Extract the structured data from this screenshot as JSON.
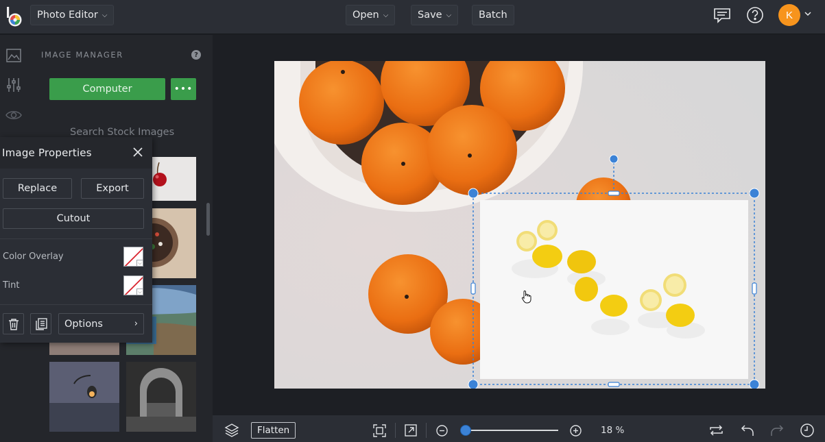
{
  "header": {
    "app_menu_label": "Photo Editor",
    "open_label": "Open",
    "save_label": "Save",
    "batch_label": "Batch",
    "avatar_initial": "K"
  },
  "image_manager": {
    "title": "IMAGE MANAGER",
    "help_glyph": "?",
    "computer_label": "Computer",
    "more_label": "•••",
    "stock_search_label": "Search Stock Images"
  },
  "image_properties": {
    "title": "Image Properties",
    "replace_label": "Replace",
    "export_label": "Export",
    "cutout_label": "Cutout",
    "color_overlay_label": "Color Overlay",
    "tint_label": "Tint",
    "options_label": "Options"
  },
  "bottom_bar": {
    "flatten_label": "Flatten",
    "zoom_text": "18 %",
    "zoom_level": 0.18
  },
  "colors": {
    "accent_blue": "#3b82d6",
    "computer_green": "#3a9d4b",
    "avatar_orange": "#f7941d"
  },
  "icons": {
    "rail": [
      "image-icon",
      "sliders-icon",
      "eye-icon"
    ],
    "header_right": [
      "comment-icon",
      "help-icon"
    ],
    "bottom": [
      "layers-icon",
      "fit-screen-icon",
      "expand-icon",
      "zoom-out-icon",
      "zoom-in-icon",
      "swap-icon",
      "undo-icon",
      "redo-icon",
      "history-icon"
    ]
  }
}
